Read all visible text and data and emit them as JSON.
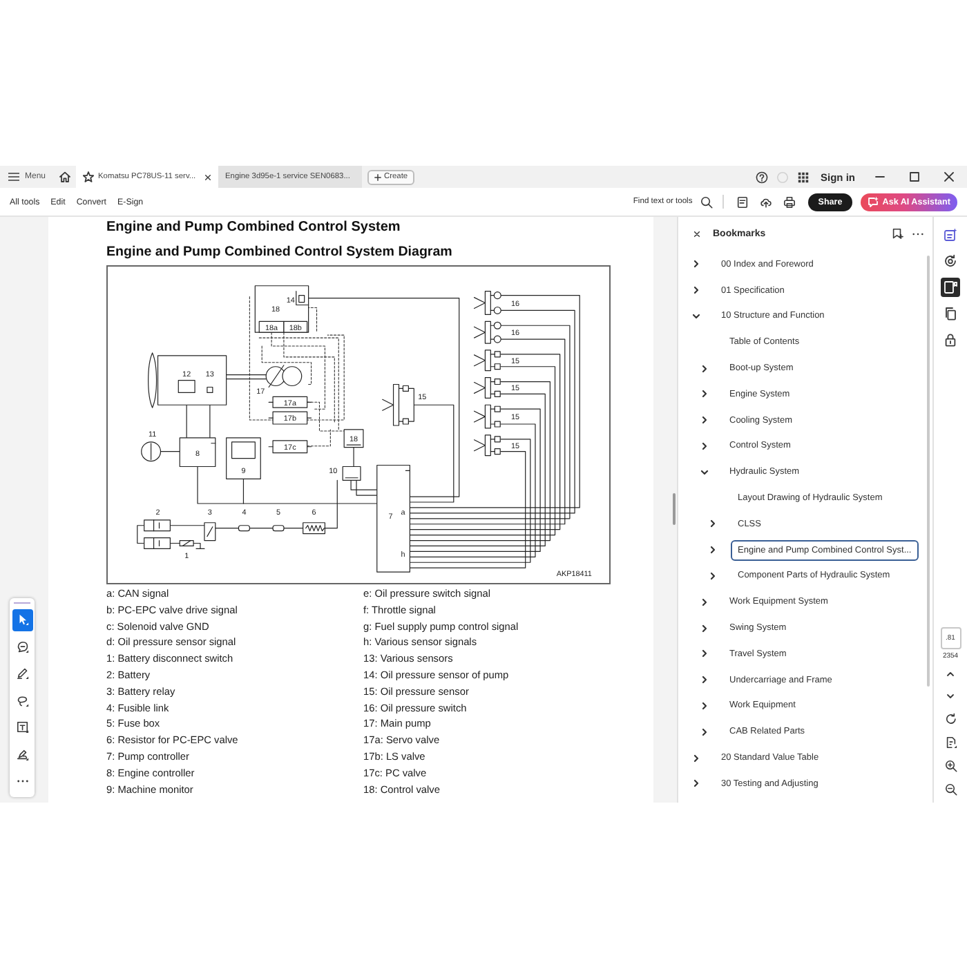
{
  "tab_bar": {
    "menu_label": "Menu",
    "tabs": [
      {
        "title": "Komatsu PC78US-11 serv...",
        "selected": true
      },
      {
        "title": "Engine 3d95e-1 service SEN0683...",
        "selected": false
      }
    ],
    "create_label": "Create",
    "sign_in": "Sign in"
  },
  "toolbar": {
    "menus": [
      "All tools",
      "Edit",
      "Convert",
      "E-Sign"
    ],
    "find_label": "Find text or tools",
    "share": "Share",
    "assistant": "Ask AI Assistant"
  },
  "tools": [
    {
      "kind": "select",
      "selected": true
    },
    {
      "kind": "comment",
      "selected": false
    },
    {
      "kind": "draw",
      "selected": false
    },
    {
      "kind": "lasso",
      "selected": false
    },
    {
      "kind": "text",
      "selected": false
    },
    {
      "kind": "stamp",
      "selected": false
    },
    {
      "kind": "more",
      "selected": false
    }
  ],
  "document": {
    "heading": "Engine and Pump Combined Control System",
    "subheading": "Engine and Pump Combined Control System Diagram",
    "diagram": {
      "components": [
        {
          "label": "18",
          "kind": "control-valve"
        },
        {
          "label": "14",
          "kind": "sensor"
        },
        {
          "label": "18a",
          "kind": "valve-section"
        },
        {
          "label": "18b",
          "kind": "valve-section"
        },
        {
          "kind": "engine"
        },
        {
          "label": "12",
          "kind": "box"
        },
        {
          "label": "13",
          "kind": "sensor"
        },
        {
          "label": "17",
          "kind": "pump"
        },
        {
          "label": "17a",
          "kind": "valve"
        },
        {
          "label": "17b",
          "kind": "valve"
        },
        {
          "label": "17c",
          "kind": "valve"
        },
        {
          "label": "11",
          "kind": "dial"
        },
        {
          "label": "8",
          "kind": "controller"
        },
        {
          "label": "9",
          "kind": "monitor"
        },
        {
          "label": "18",
          "kind": "solenoid"
        },
        {
          "label": "10",
          "kind": "solenoid"
        },
        {
          "label": "7",
          "kind": "controller"
        },
        {
          "label": "2",
          "kind": "battery"
        },
        {
          "label": "1",
          "kind": "switch"
        },
        {
          "label": "3",
          "kind": "relay"
        },
        {
          "label": "4",
          "kind": "fuse"
        },
        {
          "label": "5",
          "kind": "fuse"
        },
        {
          "label": "6",
          "kind": "resistor"
        },
        {
          "label": "15",
          "kind": "sensor-pair"
        },
        {
          "label": "16",
          "kind": "switch-pair"
        },
        {
          "label": "16",
          "kind": "switch-pair"
        },
        {
          "label": "15",
          "kind": "sensor-pair"
        },
        {
          "label": "15",
          "kind": "sensor-pair"
        },
        {
          "label": "15",
          "kind": "sensor-pair"
        },
        {
          "label": "15",
          "kind": "sensor-pair"
        }
      ],
      "pin_labels": [
        "a",
        "h"
      ],
      "figure_code": "AKP18411"
    },
    "legend": [
      [
        "a: CAN signal",
        "b: PC-EPC valve drive signal",
        "c: Solenoid valve GND",
        "d: Oil pressure sensor signal",
        "1: Battery disconnect switch",
        "2: Battery",
        "3: Battery relay",
        "4: Fusible link",
        "5: Fuse box",
        "6: Resistor for PC-EPC valve",
        "7: Pump controller",
        "8: Engine controller",
        "9: Machine monitor"
      ],
      [
        "e: Oil pressure switch signal",
        "f: Throttle signal",
        "g: Fuel supply pump control signal",
        "h: Various sensor signals",
        "13: Various sensors",
        "14: Oil pressure sensor of pump",
        "15: Oil pressure sensor",
        "16: Oil pressure switch",
        "17: Main pump",
        "17a: Servo valve",
        "17b: LS valve",
        "17c: PC valve",
        "18: Control valve"
      ]
    ]
  },
  "bookmarks": {
    "title": "Bookmarks",
    "items": [
      {
        "label": "00 Index and Foreword",
        "kind": "folder",
        "expanded": false,
        "selected": false
      },
      {
        "label": "01 Specification",
        "kind": "folder",
        "expanded": false,
        "selected": false
      },
      {
        "label": "10 Structure and Function",
        "kind": "folder",
        "expanded": true,
        "selected": false,
        "children": [
          {
            "label": "Table of Contents",
            "kind": "page",
            "expanded": false,
            "selected": false
          },
          {
            "label": "Boot-up System",
            "kind": "folder",
            "expanded": false,
            "selected": false
          },
          {
            "label": "Engine System",
            "kind": "folder",
            "expanded": false,
            "selected": false
          },
          {
            "label": "Cooling System",
            "kind": "folder",
            "expanded": false,
            "selected": false
          },
          {
            "label": "Control System",
            "kind": "folder",
            "expanded": false,
            "selected": false
          },
          {
            "label": "Hydraulic System",
            "kind": "folder",
            "expanded": true,
            "selected": false,
            "children": [
              {
                "label": "Layout Drawing of Hydraulic System",
                "kind": "page",
                "expanded": false,
                "selected": false
              },
              {
                "label": "CLSS",
                "kind": "folder",
                "expanded": false,
                "selected": false
              },
              {
                "label": "Engine and Pump Combined Control Syst...",
                "kind": "folder",
                "expanded": false,
                "selected": true
              },
              {
                "label": "Component Parts of Hydraulic System",
                "kind": "folder",
                "expanded": false,
                "selected": false
              }
            ]
          },
          {
            "label": "Work Equipment System",
            "kind": "folder",
            "expanded": false,
            "selected": false
          },
          {
            "label": "Swing System",
            "kind": "folder",
            "expanded": false,
            "selected": false
          },
          {
            "label": "Travel System",
            "kind": "folder",
            "expanded": false,
            "selected": false
          },
          {
            "label": "Undercarriage and Frame",
            "kind": "folder",
            "expanded": false,
            "selected": false
          },
          {
            "label": "Work Equipment",
            "kind": "folder",
            "expanded": false,
            "selected": false
          },
          {
            "label": "CAB Related Parts",
            "kind": "folder",
            "expanded": false,
            "selected": false
          }
        ]
      },
      {
        "label": "20 Standard Value Table",
        "kind": "folder",
        "expanded": false,
        "selected": false
      },
      {
        "label": "30 Testing and Adjusting",
        "kind": "folder",
        "expanded": false,
        "selected": false
      }
    ]
  },
  "side_rail": {
    "tools": [
      {
        "kind": "ai",
        "selected": false
      },
      {
        "kind": "convert",
        "selected": false
      },
      {
        "kind": "bookmarks",
        "selected": true
      },
      {
        "kind": "pages",
        "selected": false
      },
      {
        "kind": "protect",
        "selected": false
      }
    ],
    "page_field": {
      "value": ".81"
    },
    "page_count": "2354"
  }
}
